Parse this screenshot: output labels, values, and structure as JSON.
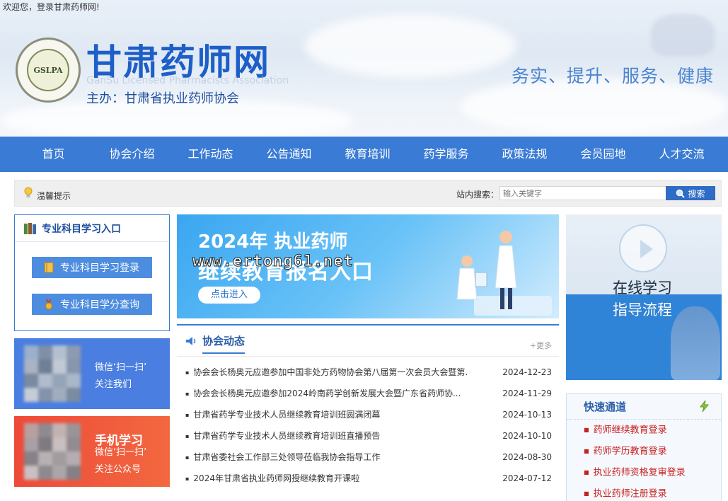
{
  "header": {
    "welcome": "欢迎您，登录甘肃药师网!",
    "logo_text": "GSLPA",
    "site_title": "甘肃药师网",
    "site_title_en": "GanSu Licensed Pharmacists Association",
    "host": "主办：甘肃省执业药师协会",
    "slogan": "务实、提升、服务、健康"
  },
  "nav": {
    "items": [
      "首页",
      "协会介绍",
      "工作动态",
      "公告通知",
      "教育培训",
      "药学服务",
      "政策法规",
      "会员园地",
      "人才交流"
    ]
  },
  "search": {
    "tip": "温馨提示",
    "label": "站内搜索：",
    "placeholder": "输入关键字",
    "button": "搜索"
  },
  "study": {
    "title": "专业科目学习入口",
    "login": "专业科目学习登录",
    "credit": "专业科目学分查询"
  },
  "promo_wechat": {
    "line1": "微信‘扫一扫’",
    "line2": "关注我们"
  },
  "promo_mobile": {
    "title": "手机学习",
    "line1": "微信‘扫一扫’",
    "line2": "关注公众号"
  },
  "banner": {
    "year": "2024年 执业药师",
    "subtitle": "继续教育报名入口",
    "button": "点击进入",
    "watermark": "www.ertong61.net"
  },
  "news": {
    "title": "协会动态",
    "more": "+更多",
    "items": [
      {
        "title": "协会会长杨奥元应邀参加中国非处方药物协会第八届第一次会员大会暨第...",
        "date": "2024-12-23"
      },
      {
        "title": "协会会长杨奥元应邀参加2024岭南药学创新发展大会暨广东省药师协...",
        "date": "2024-11-29"
      },
      {
        "title": "甘肃省药学专业技术人员继续教育培训班圆满闭幕",
        "date": "2024-10-13"
      },
      {
        "title": "甘肃省药学专业技术人员继续教育培训班直播预告",
        "date": "2024-10-10"
      },
      {
        "title": "甘肃省委社会工作部三处领导莅临我协会指导工作",
        "date": "2024-08-30"
      },
      {
        "title": "2024年甘肃省执业药师网授继续教育开课啦",
        "date": "2024-07-12"
      }
    ]
  },
  "guide": {
    "line1": "在线学习",
    "line2": "指导流程"
  },
  "quick": {
    "title": "快速通道",
    "items": [
      "药师继续教育登录",
      "药师学历教育登录",
      "执业药师资格复审登录",
      "执业药师注册登录"
    ]
  }
}
